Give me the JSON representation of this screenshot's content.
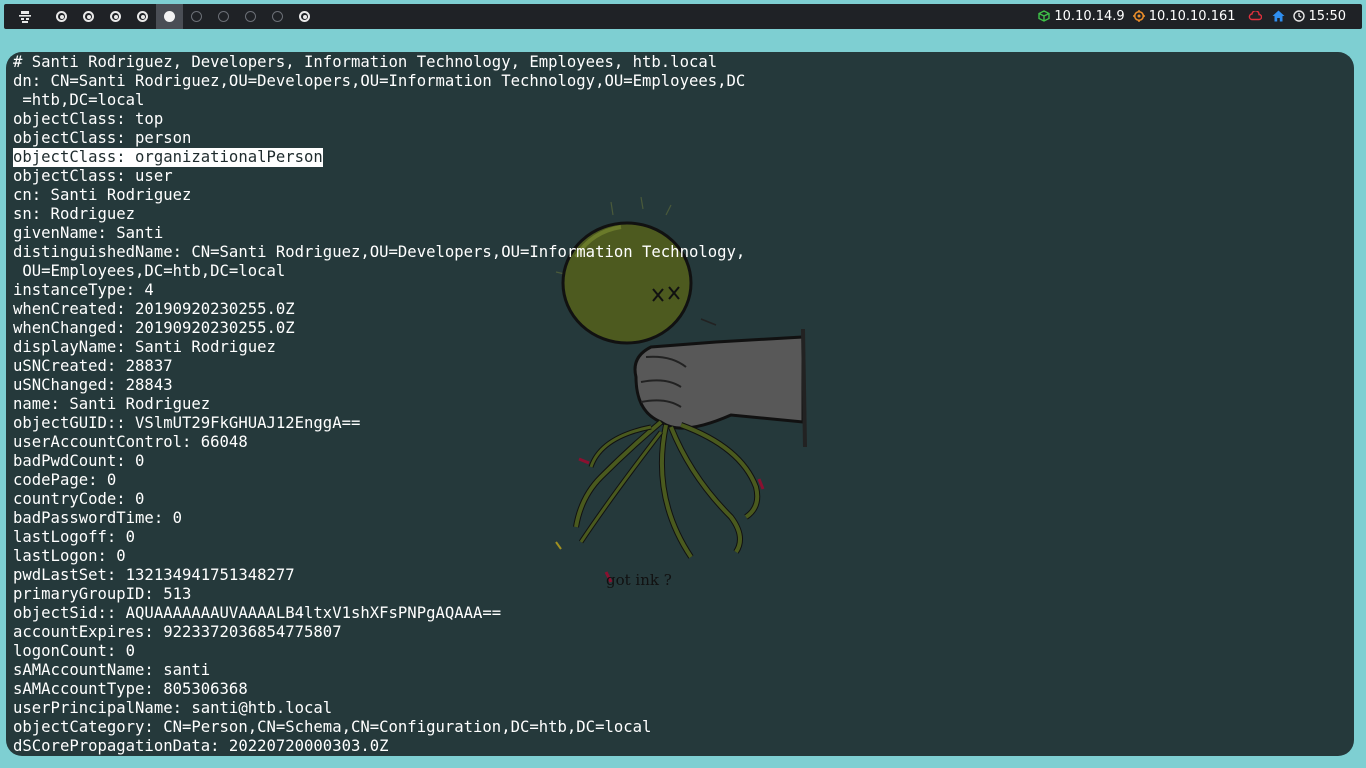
{
  "topbar": {
    "workspaces": [
      {
        "state": "filled"
      },
      {
        "state": "filled"
      },
      {
        "state": "filled"
      },
      {
        "state": "filled"
      },
      {
        "state": "active"
      },
      {
        "state": "empty"
      },
      {
        "state": "empty"
      },
      {
        "state": "empty"
      },
      {
        "state": "empty"
      },
      {
        "state": "filled"
      }
    ],
    "vpn_ip": "10.10.14.9",
    "target_ip": "10.10.10.161",
    "clock": "15:50",
    "icons": {
      "vpn": "cube-icon",
      "target": "target-icon",
      "cloud": "cloud-icon",
      "home": "home-icon",
      "clock": "clock-icon",
      "logo": "hacker-logo-icon"
    },
    "colors": {
      "vpn": "#3ec248",
      "target": "#f0902a",
      "cloud": "#e0313d",
      "home": "#2f8ff0"
    }
  },
  "terminal": {
    "lines": [
      "# Santi Rodriguez, Developers, Information Technology, Employees, htb.local",
      "dn: CN=Santi Rodriguez,OU=Developers,OU=Information Technology,OU=Employees,DC",
      " =htb,DC=local",
      "objectClass: top",
      "objectClass: person",
      "objectClass: organizationalPerson",
      "objectClass: user",
      "cn: Santi Rodriguez",
      "sn: Rodriguez",
      "givenName: Santi",
      "distinguishedName: CN=Santi Rodriguez,OU=Developers,OU=Information Technology,",
      " OU=Employees,DC=htb,DC=local",
      "instanceType: 4",
      "whenCreated: 20190920230255.0Z",
      "whenChanged: 20190920230255.0Z",
      "displayName: Santi Rodriguez",
      "uSNCreated: 28837",
      "uSNChanged: 28843",
      "name: Santi Rodriguez",
      "objectGUID:: VSlmUT29FkGHUAJ12EnggA==",
      "userAccountControl: 66048",
      "badPwdCount: 0",
      "codePage: 0",
      "countryCode: 0",
      "badPasswordTime: 0",
      "lastLogoff: 0",
      "lastLogon: 0",
      "pwdLastSet: 132134941751348277",
      "primaryGroupID: 513",
      "objectSid:: AQUAAAAAAAUVAAAALB4ltxV1shXFsPNPgAQAAA==",
      "accountExpires: 9223372036854775807",
      "logonCount: 0",
      "sAMAccountName: santi",
      "sAMAccountType: 805306368",
      "userPrincipalName: santi@htb.local",
      "objectCategory: CN=Person,CN=Schema,CN=Configuration,DC=htb,DC=local",
      "dSCorePropagationData: 20220720000303.0Z"
    ],
    "selected_line": 5
  },
  "wallpaper": {
    "caption": "got ink ?",
    "colors": {
      "head": "#4d5a1f",
      "hand": "#585858",
      "tentacle": "#4a5a1e"
    }
  }
}
